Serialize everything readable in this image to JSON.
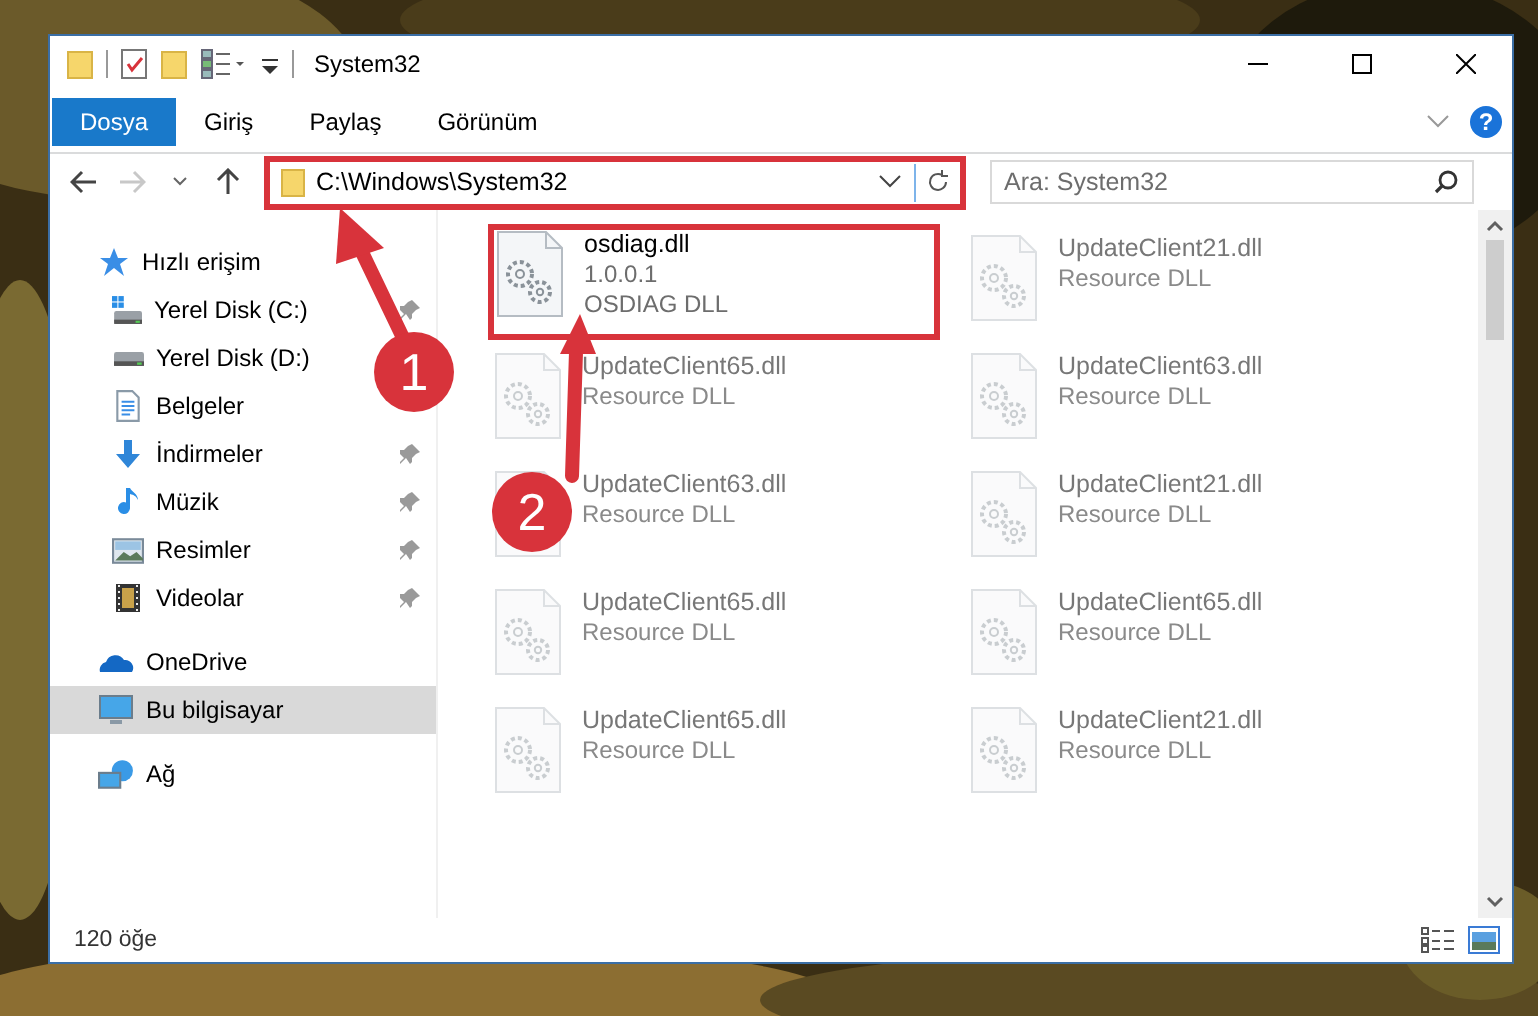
{
  "window": {
    "title": "System32"
  },
  "ribbon_tabs": [
    {
      "label": "Dosya",
      "selected": true
    },
    {
      "label": "Giriş",
      "selected": false
    },
    {
      "label": "Paylaş",
      "selected": false
    },
    {
      "label": "Görünüm",
      "selected": false
    }
  ],
  "help": "?",
  "address": {
    "path": "C:\\Windows\\System32",
    "highlighted": true
  },
  "search": {
    "placeholder": "Ara: System32"
  },
  "sidebar": {
    "items": [
      {
        "label": "Hızlı erişim",
        "kind": "star",
        "selected": false,
        "pinned": false,
        "children": [
          {
            "label": "Yerel Disk (C:)",
            "kind": "drive-win",
            "selected": false,
            "pinned": true
          },
          {
            "label": "Yerel Disk (D:)",
            "kind": "drive",
            "selected": false,
            "pinned": false
          },
          {
            "label": "Belgeler",
            "kind": "docs",
            "selected": false,
            "pinned": false
          },
          {
            "label": "İndirmeler",
            "kind": "download",
            "selected": false,
            "pinned": true
          },
          {
            "label": "Müzik",
            "kind": "music",
            "selected": false,
            "pinned": true
          },
          {
            "label": "Resimler",
            "kind": "pictures",
            "selected": false,
            "pinned": true
          },
          {
            "label": "Videolar",
            "kind": "video",
            "selected": false,
            "pinned": true
          }
        ]
      },
      {
        "label": "OneDrive",
        "kind": "cloud",
        "selected": false,
        "pinned": false
      },
      {
        "label": "Bu bilgisayar",
        "kind": "pc",
        "selected": true,
        "pinned": false
      },
      {
        "label": "Ağ",
        "kind": "network",
        "selected": false,
        "pinned": false
      }
    ]
  },
  "files": [
    {
      "name": "osdiag.dll",
      "lines": [
        "1.0.0.1",
        "OSDIAG DLL"
      ],
      "dimmed": false,
      "highlighted": true
    },
    {
      "name": "UpdateClient21.dll",
      "lines": [
        "Resource DLL"
      ],
      "dimmed": true,
      "highlighted": false
    },
    {
      "name": "UpdateClient65.dll",
      "lines": [
        "Resource DLL"
      ],
      "dimmed": true,
      "highlighted": false
    },
    {
      "name": "UpdateClient63.dll",
      "lines": [
        "Resource DLL"
      ],
      "dimmed": true,
      "highlighted": false
    },
    {
      "name": "UpdateClient63.dll",
      "lines": [
        "Resource DLL"
      ],
      "dimmed": true,
      "highlighted": false
    },
    {
      "name": "UpdateClient21.dll",
      "lines": [
        "Resource DLL"
      ],
      "dimmed": true,
      "highlighted": false
    },
    {
      "name": "UpdateClient65.dll",
      "lines": [
        "Resource DLL"
      ],
      "dimmed": true,
      "highlighted": false
    },
    {
      "name": "UpdateClient65.dll",
      "lines": [
        "Resource DLL"
      ],
      "dimmed": true,
      "highlighted": false
    },
    {
      "name": "UpdateClient65.dll",
      "lines": [
        "Resource DLL"
      ],
      "dimmed": true,
      "highlighted": false
    },
    {
      "name": "UpdateClient21.dll",
      "lines": [
        "Resource DLL"
      ],
      "dimmed": true,
      "highlighted": false
    }
  ],
  "status_bar": {
    "count": "120 öğe"
  },
  "annotations": [
    {
      "label": "1"
    },
    {
      "label": "2"
    }
  ]
}
